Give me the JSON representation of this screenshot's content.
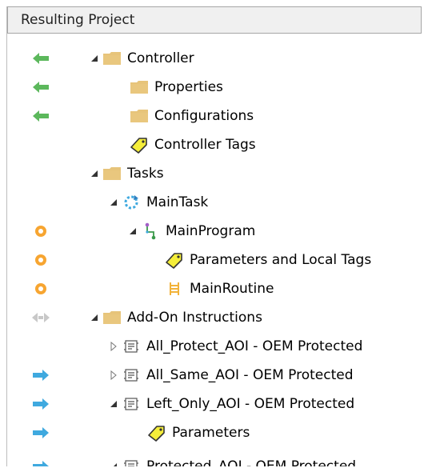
{
  "header": {
    "title": "Resulting Project"
  },
  "colors": {
    "folder": "#E7C47A",
    "tag": "#F5EE3A",
    "green_arrow": "#5CB85C",
    "blue_arrow": "#3FA9DF",
    "orange_circle": "#F7A531"
  },
  "tree": [
    {
      "label": "Controller",
      "status": "green-arrow-left",
      "expanded": true,
      "icon": "folder"
    },
    {
      "label": "Properties",
      "status": "green-arrow-left",
      "icon": "folder"
    },
    {
      "label": "Configurations",
      "status": "green-arrow-left",
      "icon": "folder"
    },
    {
      "label": "Controller Tags",
      "status": "none",
      "icon": "tag"
    },
    {
      "label": "Tasks",
      "status": "none",
      "expanded": true,
      "icon": "folder"
    },
    {
      "label": "MainTask",
      "status": "none",
      "expanded": true,
      "icon": "task-cycle"
    },
    {
      "label": "MainProgram",
      "status": "orange-circle",
      "expanded": true,
      "icon": "program"
    },
    {
      "label": "Parameters and Local Tags",
      "status": "orange-circle",
      "icon": "tag"
    },
    {
      "label": "MainRoutine",
      "status": "orange-circle",
      "icon": "ladder-routine"
    },
    {
      "label": "Add-On Instructions",
      "status": "gray-bidirectional-arrows",
      "expanded": true,
      "icon": "folder"
    },
    {
      "label": "All_Protect_AOI - OEM Protected",
      "status": "none",
      "expanded": false,
      "icon": "aoi"
    },
    {
      "label": "All_Same_AOI - OEM Protected",
      "status": "blue-arrow-right",
      "expanded": false,
      "icon": "aoi"
    },
    {
      "label": "Left_Only_AOI - OEM Protected",
      "status": "blue-arrow-right",
      "expanded": true,
      "icon": "aoi"
    },
    {
      "label": "Parameters",
      "status": "blue-arrow-right",
      "icon": "tag"
    },
    {
      "label": "Protected_AOI - OEM Protected",
      "status": "blue-arrow-right",
      "expanded": true,
      "icon": "aoi"
    }
  ]
}
